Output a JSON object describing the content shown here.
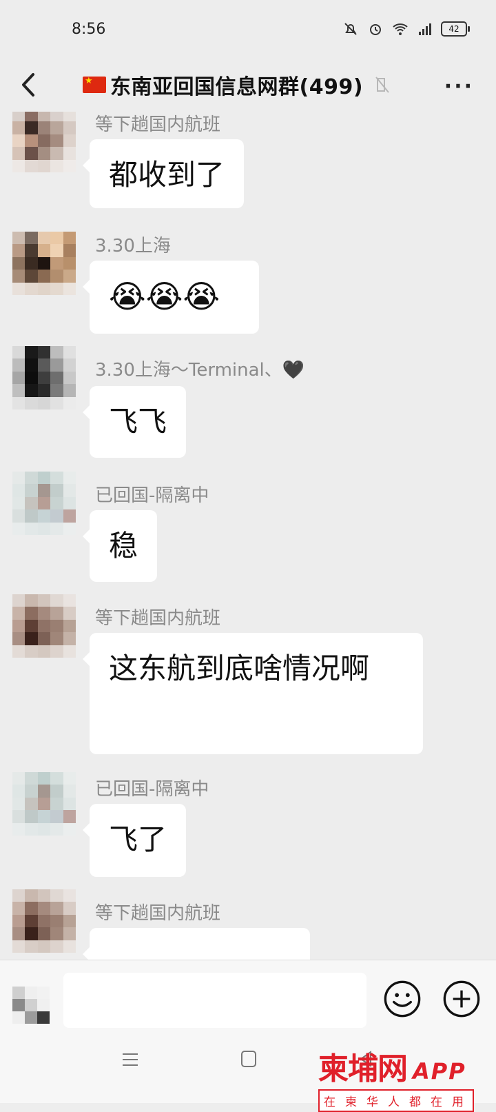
{
  "status": {
    "time": "8:56",
    "battery": "42"
  },
  "header": {
    "title": "东南亚回国信息网群(499)",
    "more": "···"
  },
  "messages": [
    {
      "nick": "等下趟国内航班",
      "text": "都收到了"
    },
    {
      "nick": "3.30上海",
      "text": "😭😭😭"
    },
    {
      "nick": "3.30上海～Terminal、🖤",
      "text": "飞飞"
    },
    {
      "nick": "已回国-隔离中",
      "text": "稳"
    },
    {
      "nick": "等下趟国内航班",
      "text": "这东航到底啥情况啊"
    },
    {
      "nick": "已回国-隔离中",
      "text": "飞了"
    },
    {
      "nick": "等下趟国内航班",
      "text": ""
    }
  ],
  "input": {
    "placeholder": ""
  },
  "watermark": {
    "brand": "柬埔网",
    "app": "APP",
    "sub": "在柬华人都在用"
  },
  "colors": {
    "background": "#ededed",
    "bubble": "#ffffff",
    "accent_red": "#e0202a"
  }
}
